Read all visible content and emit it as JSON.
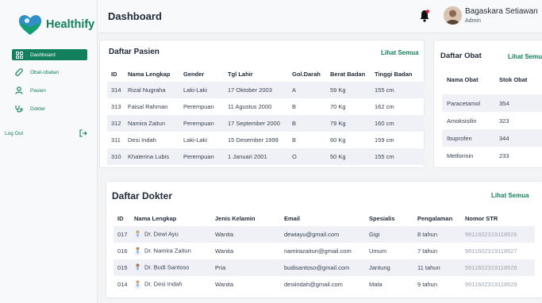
{
  "brand": {
    "name": "Healthify",
    "color": "#12805c"
  },
  "sidebar": {
    "items": [
      {
        "label": "Dashboard",
        "icon": "dashboard-icon"
      },
      {
        "label": "Obat-obatan",
        "icon": "pill-icon"
      },
      {
        "label": "Pasien",
        "icon": "user-icon"
      },
      {
        "label": "Dokter",
        "icon": "stethoscope-icon"
      }
    ],
    "logout_label": "Log Out"
  },
  "header": {
    "title": "Dashboard"
  },
  "user": {
    "name": "Bagaskara Setiawan",
    "role": "Admin"
  },
  "patients": {
    "title": "Daftar Pasien",
    "see_all": "Lihat Semua",
    "columns": [
      "ID",
      "Nama Lengkap",
      "Gender",
      "Tgl Lahir",
      "Gol.Darah",
      "Berat Badan",
      "Tinggi Badan"
    ],
    "rows": [
      [
        "314",
        "Rizal Nugraha",
        "Laki-Laki",
        "17 Oktober 2003",
        "A",
        "59 Kg",
        "155 cm"
      ],
      [
        "313",
        "Faisal Rahman",
        "Perempuan",
        "11 Agustus 2000",
        "B",
        "70 Kg",
        "162 cm"
      ],
      [
        "312",
        "Namira Zaitun",
        "Perempuan",
        "17 September 2000",
        "B",
        "79 Kg",
        "160 cm"
      ],
      [
        "311",
        "Desi Indah",
        "Laki-Laki",
        "15 Desember 1999",
        "B",
        "60 Kg",
        "159 cm"
      ],
      [
        "310",
        "Khaterina Lubis",
        "Perempuan",
        "1 Januari 2001",
        "O",
        "50 Kg",
        "155 cm"
      ]
    ]
  },
  "medicines": {
    "title": "Daftar Obat",
    "see_all": "Lihat Semua",
    "columns": [
      "Nama Obat",
      "Stok Obat"
    ],
    "rows": [
      [
        "Paracetamol",
        "354"
      ],
      [
        "Amoksisilin",
        "323"
      ],
      [
        "Ibuprofen",
        "344"
      ],
      [
        "Metformin",
        "233"
      ]
    ]
  },
  "doctors": {
    "title": "Daftar Dokter",
    "see_all": "Lihat Semua",
    "columns": [
      "ID",
      "Nama Lengkap",
      "Jenis Kelamin",
      "Email",
      "Spesialis",
      "Pengalaman",
      "Nomor STR"
    ],
    "rows": [
      [
        "017",
        "Dr. Dewi Ayu",
        "Wanita",
        "dewiayu@gmail.com",
        "Gigi",
        "8 tahun",
        "9911602319118526"
      ],
      [
        "016",
        "Dr. Namira Zaitun",
        "Wanita",
        "namirazaitun@gmail.com",
        "Umum",
        "7 tahun",
        "9911602319118527"
      ],
      [
        "015",
        "Dr. Budi Santoso",
        "Pria",
        "budisantoso@gmail.com",
        "Jantung",
        "11 tahun",
        "9911602319118528"
      ],
      [
        "014",
        "Dr. Desi Indah",
        "Wanita",
        "desiindah@gmail.com",
        "Mata",
        "9 tahun",
        "9911602319118529"
      ]
    ]
  }
}
